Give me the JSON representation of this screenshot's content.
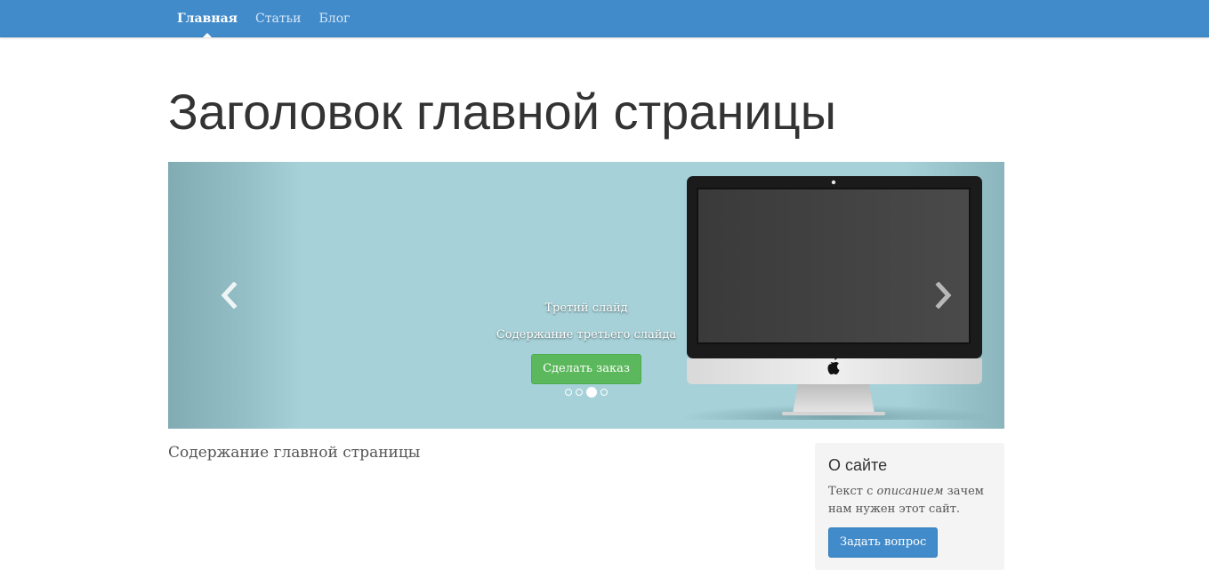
{
  "navbar": {
    "items": [
      {
        "label": "Главная",
        "active": true
      },
      {
        "label": "Статьи",
        "active": false
      },
      {
        "label": "Блог",
        "active": false
      }
    ],
    "color": "#428bca"
  },
  "page": {
    "title": "Заголовок главной страницы",
    "content": "Содержание главной страницы"
  },
  "carousel": {
    "slide_title": "Третий слайд",
    "slide_text": "Содержание третьего слайда",
    "button_label": "Сделать заказ",
    "indicator_count": 4,
    "active_index": 2,
    "prev_icon": "chevron-left-icon",
    "next_icon": "chevron-right-icon",
    "image": "imac-monitor"
  },
  "sidebar": {
    "title": "О сайте",
    "text_before": "Текст с ",
    "text_em": "описанием",
    "text_after": " зачем нам нужен этот сайт.",
    "button_label": "Задать вопрос"
  }
}
